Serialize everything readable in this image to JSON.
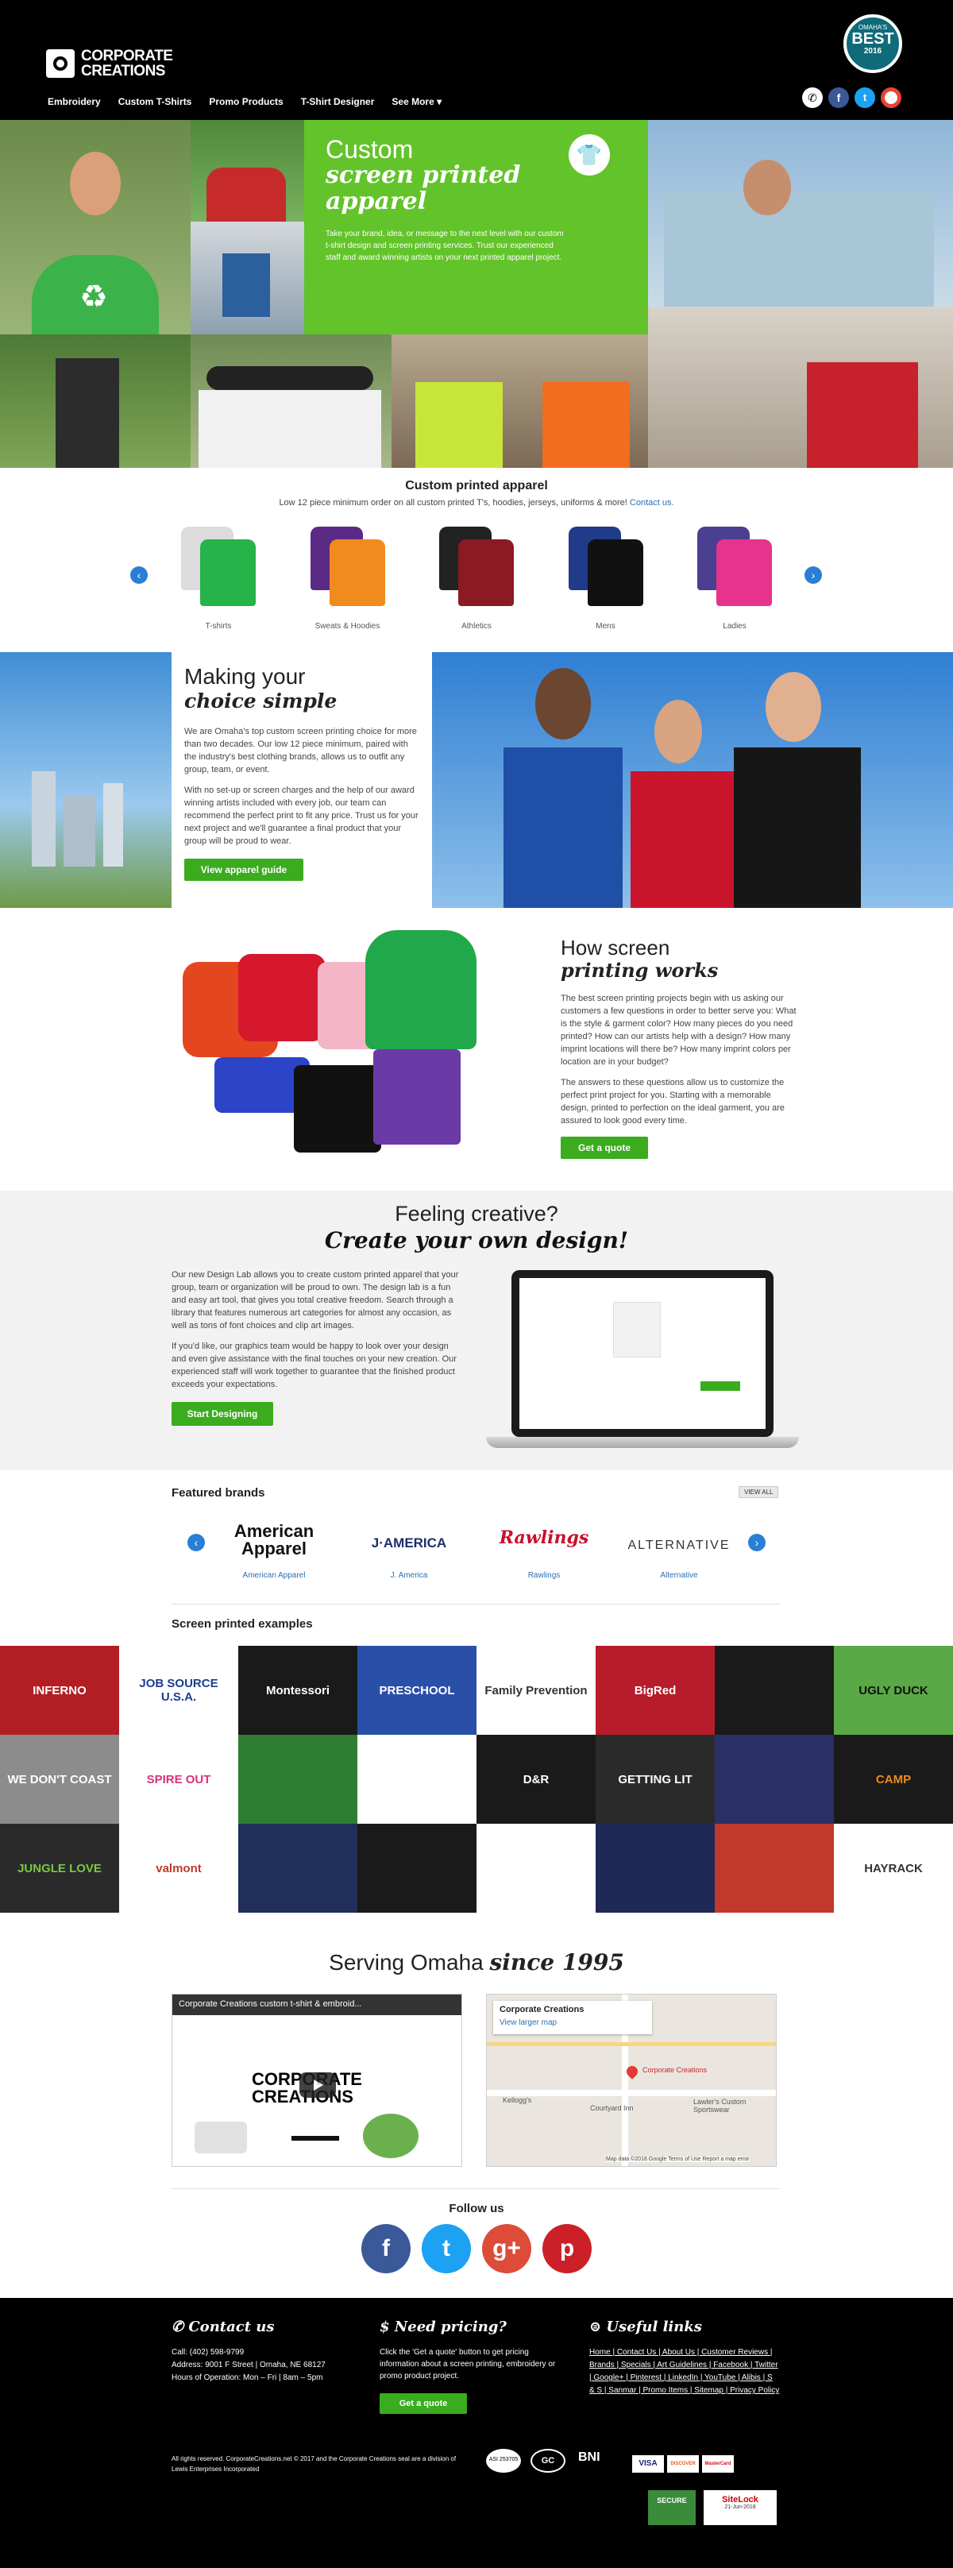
{
  "header": {
    "logo_line1": "CORPORATE",
    "logo_line2": "CREATIONS",
    "nav": [
      "Embroidery",
      "Custom T-Shirts",
      "Promo Products",
      "T-Shirt Designer",
      "See More ▾"
    ],
    "badge_top": "OMAHA'S",
    "badge_main": "BEST",
    "badge_year": "2016",
    "social": [
      "phone-icon",
      "facebook-icon",
      "twitter-icon",
      "google-icon"
    ]
  },
  "hero": {
    "title1": "Custom",
    "title2": "screen printed",
    "title3": "apparel",
    "body": "Take your brand, idea, or message to the next level with our custom t-shirt design and screen printing services. Trust our experienced staff and award winning artists on your next printed apparel project."
  },
  "apparel": {
    "heading": "Custom printed apparel",
    "sub": "Low 12 piece minimum order on all custom printed T's, hoodies, jerseys, uniforms & more!",
    "sub_link": "Contact us.",
    "items": [
      {
        "label": "T-shirts",
        "c1": "#dcdcdc",
        "c2": "#27b24a"
      },
      {
        "label": "Sweats & Hoodies",
        "c1": "#5a2a86",
        "c2": "#f28b1d"
      },
      {
        "label": "Athletics",
        "c1": "#222222",
        "c2": "#8b1a22"
      },
      {
        "label": "Mens",
        "c1": "#1f3b8a",
        "c2": "#111111"
      },
      {
        "label": "Ladies",
        "c1": "#4a3f91",
        "c2": "#e6338e"
      }
    ]
  },
  "simple": {
    "title1": "Making your",
    "title2": "choice simple",
    "p1": "We are Omaha's top custom screen printing choice for more than two decades. Our low 12 piece minimum, paired with the industry's best clothing brands, allows us to outfit any group, team, or event.",
    "p2": "With no set-up or screen charges and the help of our award winning artists included with every job, our team can recommend the perfect print to fit any price. Trust us for your next project and we'll guarantee a final product that your group will be proud to wear.",
    "button": "View apparel guide"
  },
  "how": {
    "title1": "How screen",
    "title2": "printing works",
    "p1": "The best screen printing projects begin with us asking our customers a few questions in order to better serve you: What is the style & garment color? How many pieces do you need printed? How can our artists help with a design? How many imprint locations will there be? How many imprint colors per location are in your budget?",
    "p2": "The answers to these questions allow us to customize the perfect print project for you. Starting with a memorable design, printed to perfection on the ideal garment, you are assured to look good every time.",
    "button": "Get a quote"
  },
  "creative": {
    "title1": "Feeling creative?",
    "title2": "Create your own design!",
    "p1": "Our new Design Lab allows you to create custom printed apparel that your group, team or organization will be proud to own. The design lab is a fun and easy art tool, that gives you total creative freedom. Search through a library that features numerous art categories for almost any occasion, as well as tons of font choices and clip art images.",
    "p2": "If you'd like, our graphics team would be happy to look over your design and even give assistance with the final touches on your new creation. Our experienced staff will work together to guarantee that the finished product exceeds your expectations.",
    "button": "Start Designing"
  },
  "brands": {
    "heading": "Featured brands",
    "view_all": "VIEW ALL",
    "items": [
      {
        "logo": "American Apparel",
        "link": "American Apparel"
      },
      {
        "logo": "J·AMERICA",
        "link": "J. America"
      },
      {
        "logo": "Rawlings",
        "link": "Rawlings"
      },
      {
        "logo": "ALTERNATIVE",
        "link": "Alternative"
      }
    ]
  },
  "examples": {
    "heading": "Screen printed examples",
    "tiles": [
      {
        "bg": "#b21e24",
        "fg": "#ffffff",
        "text": "INFERNO"
      },
      {
        "bg": "#ffffff",
        "fg": "#1b3f8f",
        "text": "JOB SOURCE U.S.A."
      },
      {
        "bg": "#1a1a1a",
        "fg": "#ffffff",
        "text": "Montessori"
      },
      {
        "bg": "#2a4fa8",
        "fg": "#ffffff",
        "text": "PRESCHOOL"
      },
      {
        "bg": "#ffffff",
        "fg": "#333333",
        "text": "Family Prevention"
      },
      {
        "bg": "#b71c2b",
        "fg": "#ffffff",
        "text": "BigRed"
      },
      {
        "bg": "#1a1a1a",
        "fg": "#c0392b",
        "text": ""
      },
      {
        "bg": "#5aa846",
        "fg": "#111111",
        "text": "UGLY DUCK"
      },
      {
        "bg": "#8c8c8c",
        "fg": "#ffffff",
        "text": "WE DON'T COAST"
      },
      {
        "bg": "#ffffff",
        "fg": "#d6337a",
        "text": "SPIRE OUT"
      },
      {
        "bg": "#2f7d32",
        "fg": "#ffffff",
        "text": ""
      },
      {
        "bg": "#ffffff",
        "fg": "#1b3f8f",
        "text": ""
      },
      {
        "bg": "#1a1a1a",
        "fg": "#ffffff",
        "text": "D&R"
      },
      {
        "bg": "#2a2a2a",
        "fg": "#ffffff",
        "text": "GETTING LIT"
      },
      {
        "bg": "#2a2f66",
        "fg": "#ffffff",
        "text": ""
      },
      {
        "bg": "#1a1a1a",
        "fg": "#f08a1d",
        "text": "CAMP"
      },
      {
        "bg": "#2a2a2a",
        "fg": "#7ac943",
        "text": "JUNGLE LOVE"
      },
      {
        "bg": "#ffffff",
        "fg": "#c0392b",
        "text": "valmont"
      },
      {
        "bg": "#1f2f5a",
        "fg": "#ffffff",
        "text": ""
      },
      {
        "bg": "#1a1a1a",
        "fg": "#ffffff",
        "text": ""
      },
      {
        "bg": "#ffffff",
        "fg": "#333333",
        "text": ""
      },
      {
        "bg": "#1e2a55",
        "fg": "#f1c40f",
        "text": ""
      },
      {
        "bg": "#c0392b",
        "fg": "#ffffff",
        "text": ""
      },
      {
        "bg": "#ffffff",
        "fg": "#333333",
        "text": "HAYRACK"
      }
    ]
  },
  "serving": {
    "title1": "Serving Omaha",
    "title2": "since 1995",
    "video_title": "Corporate Creations custom t-shirt & embroid...",
    "video_logo1": "CORPORATE",
    "video_logo2": "CREATIONS",
    "map_title": "Corporate Creations",
    "map_link": "View larger map",
    "map_pin": "Corporate Creations",
    "map_place1": "Courtyard Inn",
    "map_place2": "Kellogg's",
    "map_place3": "Lawler's Custom Sportswear",
    "map_footer": "Map data ©2018 Google   Terms of Use   Report a map error"
  },
  "follow": {
    "heading": "Follow us",
    "icons": [
      {
        "name": "facebook-icon",
        "glyph": "f",
        "color": "#3b5998"
      },
      {
        "name": "twitter-icon",
        "glyph": "t",
        "color": "#1da1f2"
      },
      {
        "name": "google-plus-icon",
        "glyph": "g+",
        "color": "#dd4b39"
      },
      {
        "name": "pinterest-icon",
        "glyph": "p",
        "color": "#cb2027"
      }
    ]
  },
  "footer": {
    "contact_title": "Contact us",
    "phone": "Call: (402) 598-9799",
    "address": "Address: 9001 F Street | Omaha, NE 68127",
    "hours": "Hours of Operation: Mon – Fri | 8am – 5pm",
    "pricing_title": "Need pricing?",
    "pricing_body": "Click the 'Get a quote' button to get pricing information about a screen printing, embroidery or promo product project.",
    "pricing_button": "Get a quote",
    "links_title": "Useful links",
    "links": "Home | Contact Us | About Us | Customer Reviews | Brands | Specials | Art Guidelines | Facebook | Twitter | Google+ | Pinterest | LinkedIn | YouTube | Alibis | S & S | Sanmar | Promo Items | Sitemap | Privacy Policy",
    "copyright": "All rights reserved. CorporateCreations.net © 2017 and the Corporate Creations seal are a division of Lewis Enterprises Incorporated",
    "badges": [
      "ASI 253705",
      "GC",
      "BNI",
      "VISA",
      "DISCOVER",
      "MasterCard"
    ],
    "secure": "SECURE",
    "sitelock": "SiteLock",
    "sitelock_date": "21-Jun-2018"
  }
}
